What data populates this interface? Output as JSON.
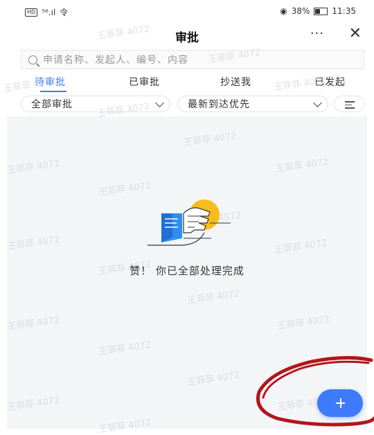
{
  "status_bar": {
    "left": "HD ⁵⁶.ıl 令",
    "hd": "HD",
    "signal": "⁵⁶.ıl",
    "wifi": "令",
    "eye": "◉",
    "battery": "38%",
    "time": "11:35"
  },
  "nav": {
    "title": "审批",
    "more": "···",
    "close": "✕"
  },
  "search": {
    "placeholder": "申请名称、发起人、编号、内容"
  },
  "tabs": [
    {
      "label": "待审批",
      "active": true
    },
    {
      "label": "已审批",
      "active": false
    },
    {
      "label": "抄送我",
      "active": false
    },
    {
      "label": "已发起",
      "active": false
    }
  ],
  "filters": {
    "scope": "全部审批",
    "sort": "最新到达优先"
  },
  "empty_state": {
    "message": "赞！ 你已全部处理完成"
  },
  "watermark": {
    "text": "王菲菲 4072"
  },
  "colors": {
    "accent": "#3e7bfa",
    "annotation": "#b3151c",
    "content_bg": "#f4f5f7"
  },
  "icons": {
    "search": "search-icon",
    "filter": "filter-lines-icon",
    "add": "plus-icon"
  }
}
